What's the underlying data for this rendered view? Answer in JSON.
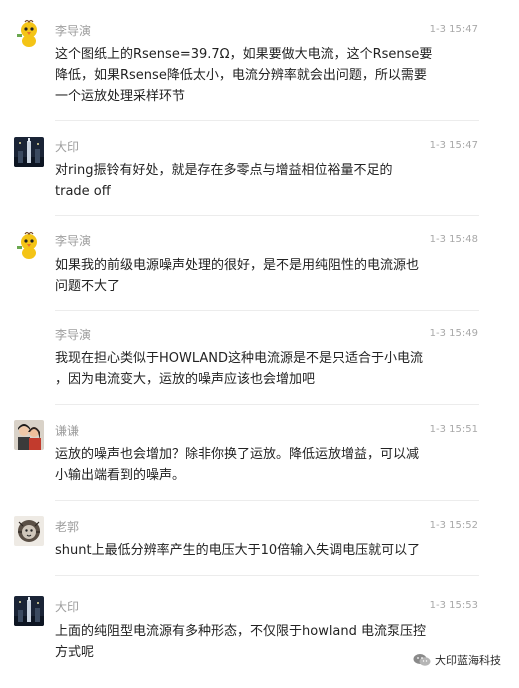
{
  "comments": [
    {
      "author": "李导演",
      "time": "1-3 15:47",
      "avatar_icon": "yellow-chick-avatar",
      "lines": [
        "这个图纸上的Rsense=39.7Ω，如果要做大电流，这个Rsense要",
        "降低，如果Rsense降低太小，电流分辨率就会出问题，所以需要",
        "一个运放处理采样环节"
      ]
    },
    {
      "author": "大印",
      "time": "1-3 15:47",
      "avatar_icon": "city-tower-avatar",
      "lines": [
        "对ring振铃有好处，就是存在多零点与增益相位裕量不足的",
        "trade off"
      ]
    },
    {
      "author": "李导演",
      "time": "1-3 15:48",
      "avatar_icon": "yellow-chick-avatar",
      "lines": [
        "如果我的前级电源噪声处理的很好，是不是用纯阻性的电流源也",
        "问题不大了"
      ]
    },
    {
      "author": "李导演",
      "time": "1-3 15:49",
      "avatar_icon": "",
      "lines": [
        "我现在担心类似于HOWLAND这种电流源是不是只适合于小电流",
        "，因为电流变大，运放的噪声应该也会增加吧"
      ]
    },
    {
      "author": "谦谦",
      "time": "1-3 15:51",
      "avatar_icon": "couple-photo-avatar",
      "lines": [
        "运放的噪声也会增加？除非你换了运放。降低运放增益，可以减",
        "小输出端看到的噪声。"
      ]
    },
    {
      "author": "老郭",
      "time": "1-3 15:52",
      "avatar_icon": "lion-sketch-avatar",
      "lines": [
        "shunt上最低分辨率产生的电压大于10倍输入失调电压就可以了"
      ]
    },
    {
      "author": "大印",
      "time": "1-3 15:53",
      "avatar_icon": "city-tower-avatar",
      "lines": [
        "上面的纯阻型电流源有多种形态，不仅限于howland 电流泵压控",
        "方式呢"
      ]
    }
  ],
  "watermark": {
    "label": "大印蓝海科技",
    "icon": "wechat-account-icon"
  }
}
